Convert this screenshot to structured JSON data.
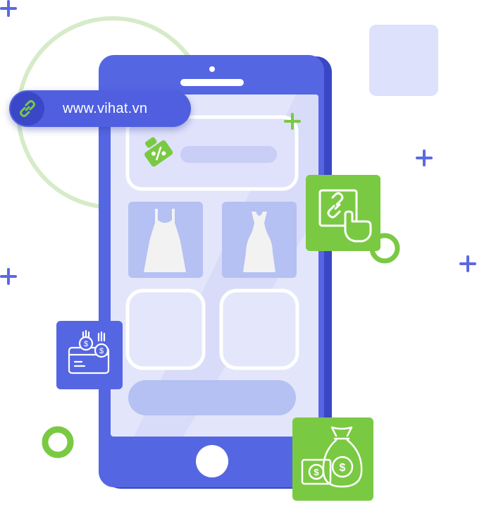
{
  "badge": {
    "url": "www.vihat.vn"
  },
  "icons": {
    "link": "link-icon",
    "coupon": "coupon-tag-icon",
    "dress_left": "dress-icon",
    "dress_right": "dress-icon",
    "click_link": "click-link-icon",
    "payment": "credit-card-payment-icon",
    "money": "money-bag-icon"
  },
  "colors": {
    "primary": "#5666e4",
    "primary_dark": "#3f4cc9",
    "green": "#7ac943",
    "screen": "#e4e7fa"
  }
}
